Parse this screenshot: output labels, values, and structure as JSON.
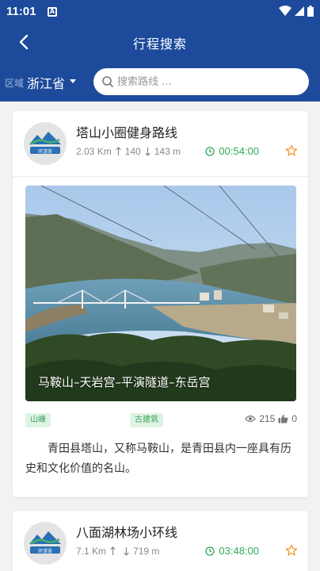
{
  "status_bar": {
    "time": "11:01",
    "notification_glyph": "A"
  },
  "header": {
    "title": "行程搜索"
  },
  "search": {
    "region_label": "区域",
    "region_value": "浙江省",
    "placeholder": "搜索路线 ..."
  },
  "colors": {
    "primary": "#1d4a9b",
    "green": "#2eaa56",
    "star": "#f29a2e",
    "tag_bg": "#dff2e4"
  },
  "routes": [
    {
      "title": "塔山小圈健身路线",
      "distance": "2.03 Km",
      "ascent": "140",
      "descent": "143 m",
      "duration": "00:54:00",
      "image_caption": "马鞍山–天岩宫–平演隧道–东岳宫",
      "tags": [
        "山峰",
        "古建筑"
      ],
      "views": "215",
      "likes": "0",
      "description": "青田县塔山，又称马鞍山，是青田县内一座具有历史和文化价值的名山。",
      "logo_text": "环游浙"
    },
    {
      "title": "八面湖林场小环线",
      "distance": "7.1 Km",
      "ascent": "",
      "descent": "719 m",
      "duration": "03:48:00",
      "logo_text": "环游浙"
    }
  ]
}
